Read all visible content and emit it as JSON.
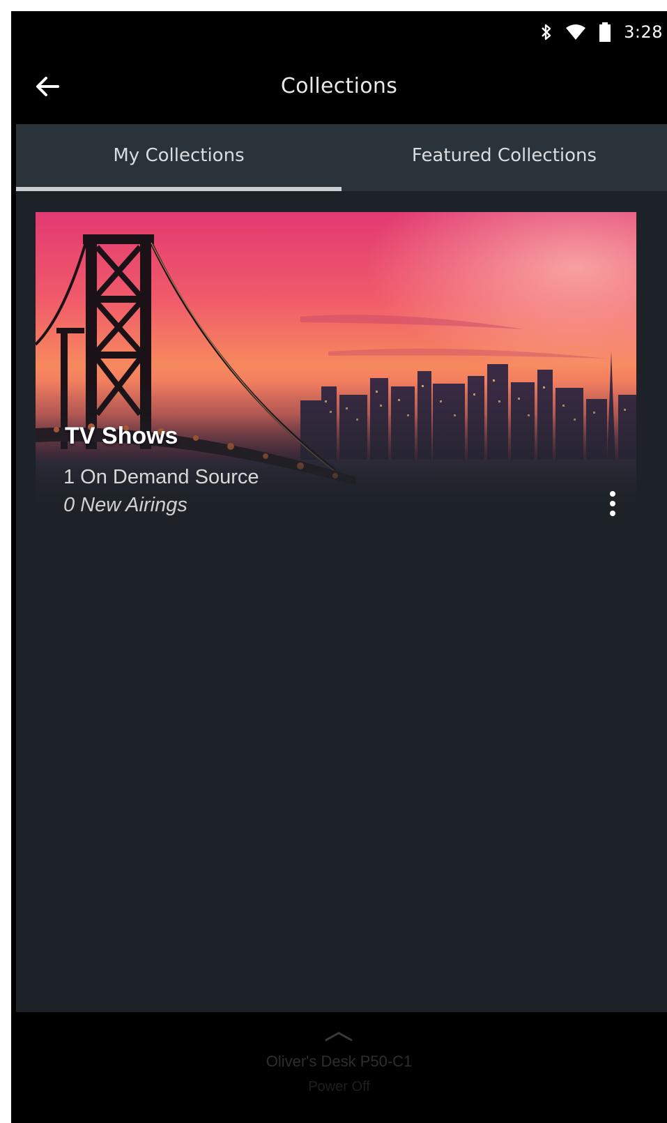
{
  "status_bar": {
    "time": "3:28",
    "icons": [
      "bluetooth-icon",
      "wifi-icon",
      "battery-icon"
    ]
  },
  "app_bar": {
    "title": "Collections",
    "back_icon": "arrow-left-icon"
  },
  "tabs": [
    {
      "label": "My Collections",
      "active": true
    },
    {
      "label": "Featured Collections",
      "active": false
    }
  ],
  "collections": [
    {
      "title": "TV Shows",
      "subtitle": "1 On Demand Source",
      "new_airings": "0 New Airings",
      "menu_icon": "more-vert-icon",
      "image": "bridge-skyline-sunset"
    }
  ],
  "bottom_bar": {
    "expand_icon": "chevron-up-icon",
    "device_name": "Oliver's Desk P50-C1",
    "device_status": "Power Off"
  },
  "colors": {
    "screen_bg": "#000000",
    "tab_bg": "#2b333a",
    "content_bg": "#1c2228",
    "tab_indicator": "#c9cfd3",
    "text_primary": "#ffffff"
  }
}
